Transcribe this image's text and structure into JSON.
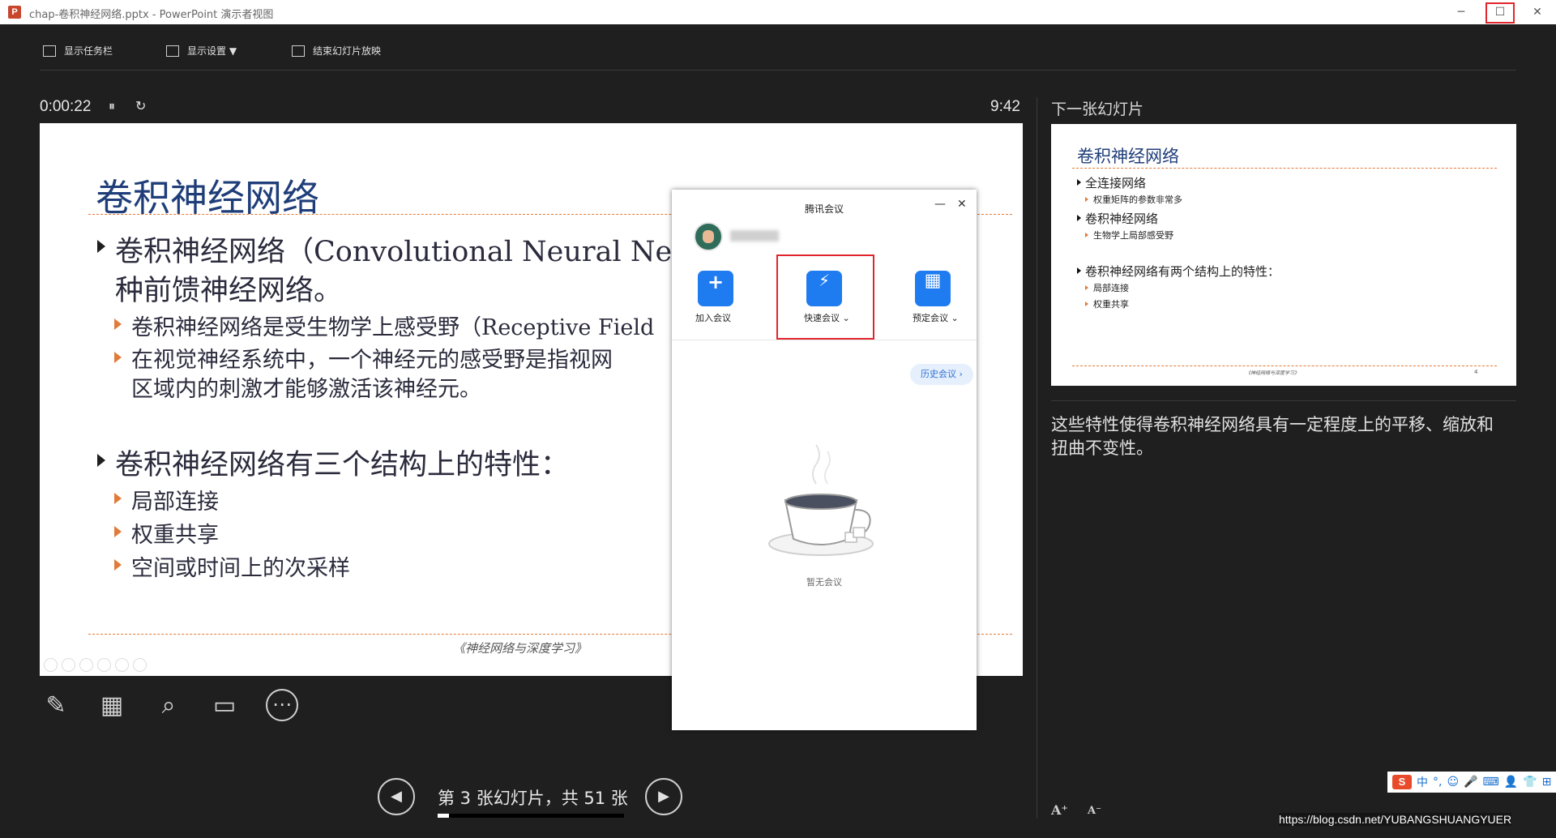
{
  "window": {
    "app_icon": "P",
    "title": "chap-卷积神经网络.pptx - PowerPoint 演示者视图",
    "minimize": "─",
    "maximize": "☐",
    "close": "✕"
  },
  "toolbar": {
    "taskbar_label": "显示任务栏",
    "display_settings_label": "显示设置 ▼",
    "end_show_label": "结束幻灯片放映"
  },
  "timer": {
    "elapsed": "0:00:22",
    "pause": "⏸",
    "reset": "↻",
    "clock": "9:42"
  },
  "slide": {
    "title": "卷积神经网络",
    "bullets": [
      {
        "level": 1,
        "text": "卷积神经网络（Convolutional Neural Net"
      },
      {
        "level": 0,
        "text": "种前馈神经网络。"
      },
      {
        "level": 2,
        "text": "卷积神经网络是受生物学上感受野（Receptive Field"
      },
      {
        "level": 2,
        "text": "在视觉神经系统中，一个神经元的感受野是指视网"
      },
      {
        "level": 0,
        "text": "区域内的刺激才能够激活该神经元。"
      },
      {
        "level": 1,
        "text": "卷积神经网络有三个结构上的特性："
      },
      {
        "level": 2,
        "text": "局部连接"
      },
      {
        "level": 2,
        "text": "权重共享"
      },
      {
        "level": 2,
        "text": "空间或时间上的次采样"
      }
    ],
    "footer": "《神经网络与深度学习》"
  },
  "tools": {
    "pen": "✎",
    "view_all": "▦",
    "zoom": "⌕",
    "black_screen": "▭",
    "more": "⋯"
  },
  "navigation": {
    "prev": "◀",
    "next": "▶",
    "status": "第 3 张幻灯片，共 51 张",
    "progress_fraction": 0.0588
  },
  "next_slide": {
    "label": "下一张幻灯片",
    "title": "卷积神经网络",
    "items": [
      {
        "level": 1,
        "text": "全连接网络"
      },
      {
        "level": 2,
        "text": "权重矩阵的参数非常多"
      },
      {
        "level": 1,
        "text": "卷积神经网络"
      },
      {
        "level": 2,
        "text": "生物学上局部感受野"
      },
      {
        "level": 1,
        "text": "卷积神经网络有两个结构上的特性："
      },
      {
        "level": 2,
        "text": "局部连接"
      },
      {
        "level": 2,
        "text": "权重共享"
      }
    ],
    "footer": "《神经网络与深度学习》",
    "page_num": "4"
  },
  "notes": {
    "text": "这些特性使得卷积神经网络具有一定程度上的平移、缩放和扭曲不变性。"
  },
  "font_controls": {
    "increase": "A⁺",
    "decrease": "A⁻"
  },
  "ime": {
    "logo": "S",
    "lang": "中",
    "punct": "°,",
    "emoji": "☺",
    "mic": "🎤",
    "keyboard": "⌨",
    "user": "👤",
    "shirt": "👕",
    "grid": "⊞"
  },
  "watermark": "https://blog.csdn.net/YUBANGSHUANGYUER",
  "meeting": {
    "title": "腾讯会议",
    "minimize": "—",
    "close": "✕",
    "join_icon": "+",
    "join_label": "加入会议",
    "quick_icon": "⚡",
    "quick_label": "快速会议 ⌄",
    "schedule_icon": "▦",
    "schedule_label": "预定会议 ⌄",
    "history_label": "历史会议 ›",
    "empty_label": "暂无会议"
  },
  "colors": {
    "slide_title": "#1f3e79",
    "accent_orange": "#e07b39",
    "meeting_blue": "#1f7cf0",
    "highlight_red": "#e0262c"
  }
}
